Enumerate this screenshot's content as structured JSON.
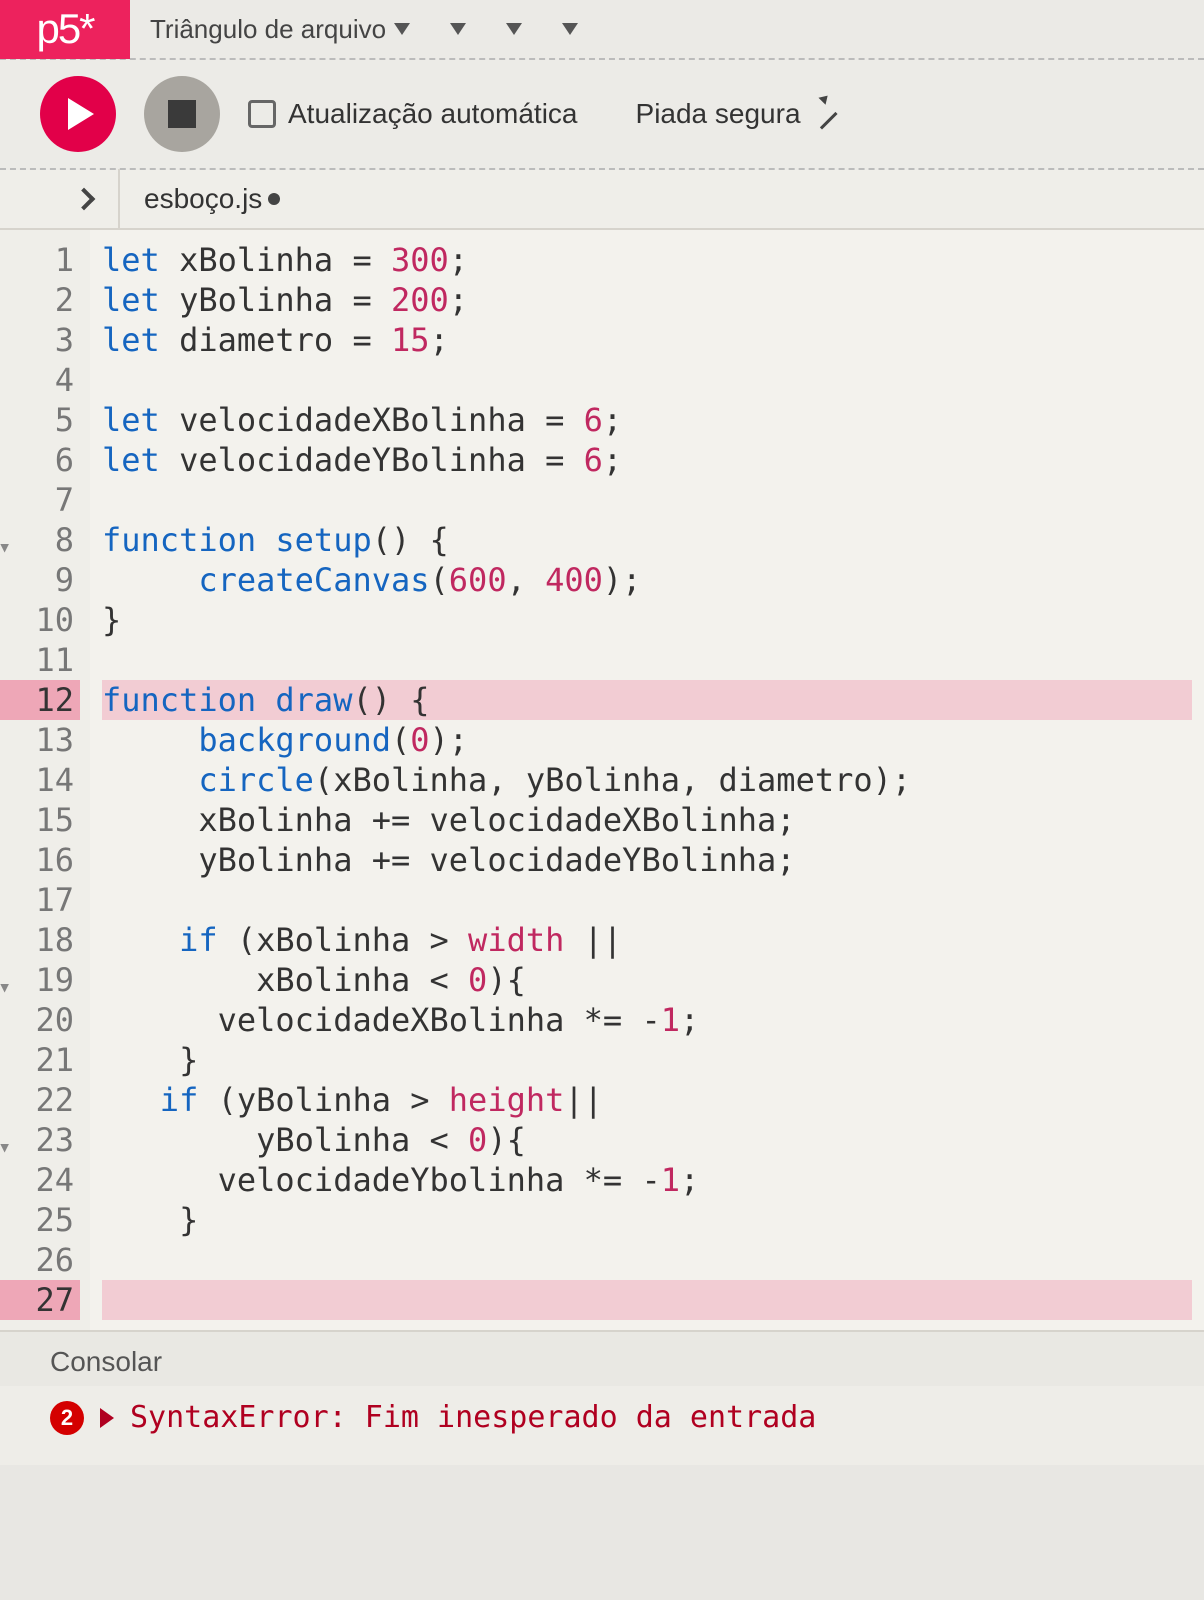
{
  "header": {
    "logo": "p5*",
    "menu_file": "Triângulo de arquivo"
  },
  "toolbar": {
    "auto_refresh_label": "Atualização automática",
    "sketch_name": "Piada segura"
  },
  "file_tab": {
    "name": "esboço.js"
  },
  "editor": {
    "error_lines": [
      12,
      27
    ],
    "fold_lines": [
      8,
      19,
      23
    ],
    "lines": [
      {
        "n": 1,
        "html": "<span class='kw'>let</span> xBolinha = <span class='num'>300</span>;"
      },
      {
        "n": 2,
        "html": "<span class='kw'>let</span> yBolinha = <span class='num'>200</span>;"
      },
      {
        "n": 3,
        "html": "<span class='kw'>let</span> diametro = <span class='num'>15</span>;"
      },
      {
        "n": 4,
        "html": ""
      },
      {
        "n": 5,
        "html": "<span class='kw'>let</span> velocidadeXBolinha = <span class='num'>6</span>;"
      },
      {
        "n": 6,
        "html": "<span class='kw'>let</span> velocidadeYBolinha = <span class='num'>6</span>;"
      },
      {
        "n": 7,
        "html": ""
      },
      {
        "n": 8,
        "html": "<span class='kw'>function</span> <span class='fn'>setup</span>() {"
      },
      {
        "n": 9,
        "html": "     <span class='fn'>createCanvas</span>(<span class='num'>600</span>, <span class='num'>400</span>);"
      },
      {
        "n": 10,
        "html": "}"
      },
      {
        "n": 11,
        "html": ""
      },
      {
        "n": 12,
        "html": "<span class='kw'>function</span> <span class='fn'>draw</span>() {"
      },
      {
        "n": 13,
        "html": "     <span class='fn'>background</span>(<span class='num'>0</span>);"
      },
      {
        "n": 14,
        "html": "     <span class='fn'>circle</span>(xBolinha, yBolinha, diametro);"
      },
      {
        "n": 15,
        "html": "     xBolinha += velocidadeXBolinha;"
      },
      {
        "n": 16,
        "html": "     yBolinha += velocidadeYBolinha;"
      },
      {
        "n": 17,
        "html": ""
      },
      {
        "n": 18,
        "html": "    <span class='kw'>if</span> (xBolinha &gt; <span class='builtin'>width</span> ||"
      },
      {
        "n": 19,
        "html": "        xBolinha &lt; <span class='num'>0</span>){"
      },
      {
        "n": 20,
        "html": "      velocidadeXBolinha *= -<span class='num'>1</span>;"
      },
      {
        "n": 21,
        "html": "    }"
      },
      {
        "n": 22,
        "html": "   <span class='kw'>if</span> (yBolinha &gt; <span class='builtin'>height</span>||"
      },
      {
        "n": 23,
        "html": "        yBolinha &lt; <span class='num'>0</span>){"
      },
      {
        "n": 24,
        "html": "      velocidadeYbolinha *= -<span class='num'>1</span>;"
      },
      {
        "n": 25,
        "html": "    }"
      },
      {
        "n": 26,
        "html": ""
      },
      {
        "n": 27,
        "html": ""
      }
    ]
  },
  "console": {
    "title": "Consolar",
    "error_count": "2",
    "error_message": "SyntaxError: Fim inesperado da entrada"
  }
}
